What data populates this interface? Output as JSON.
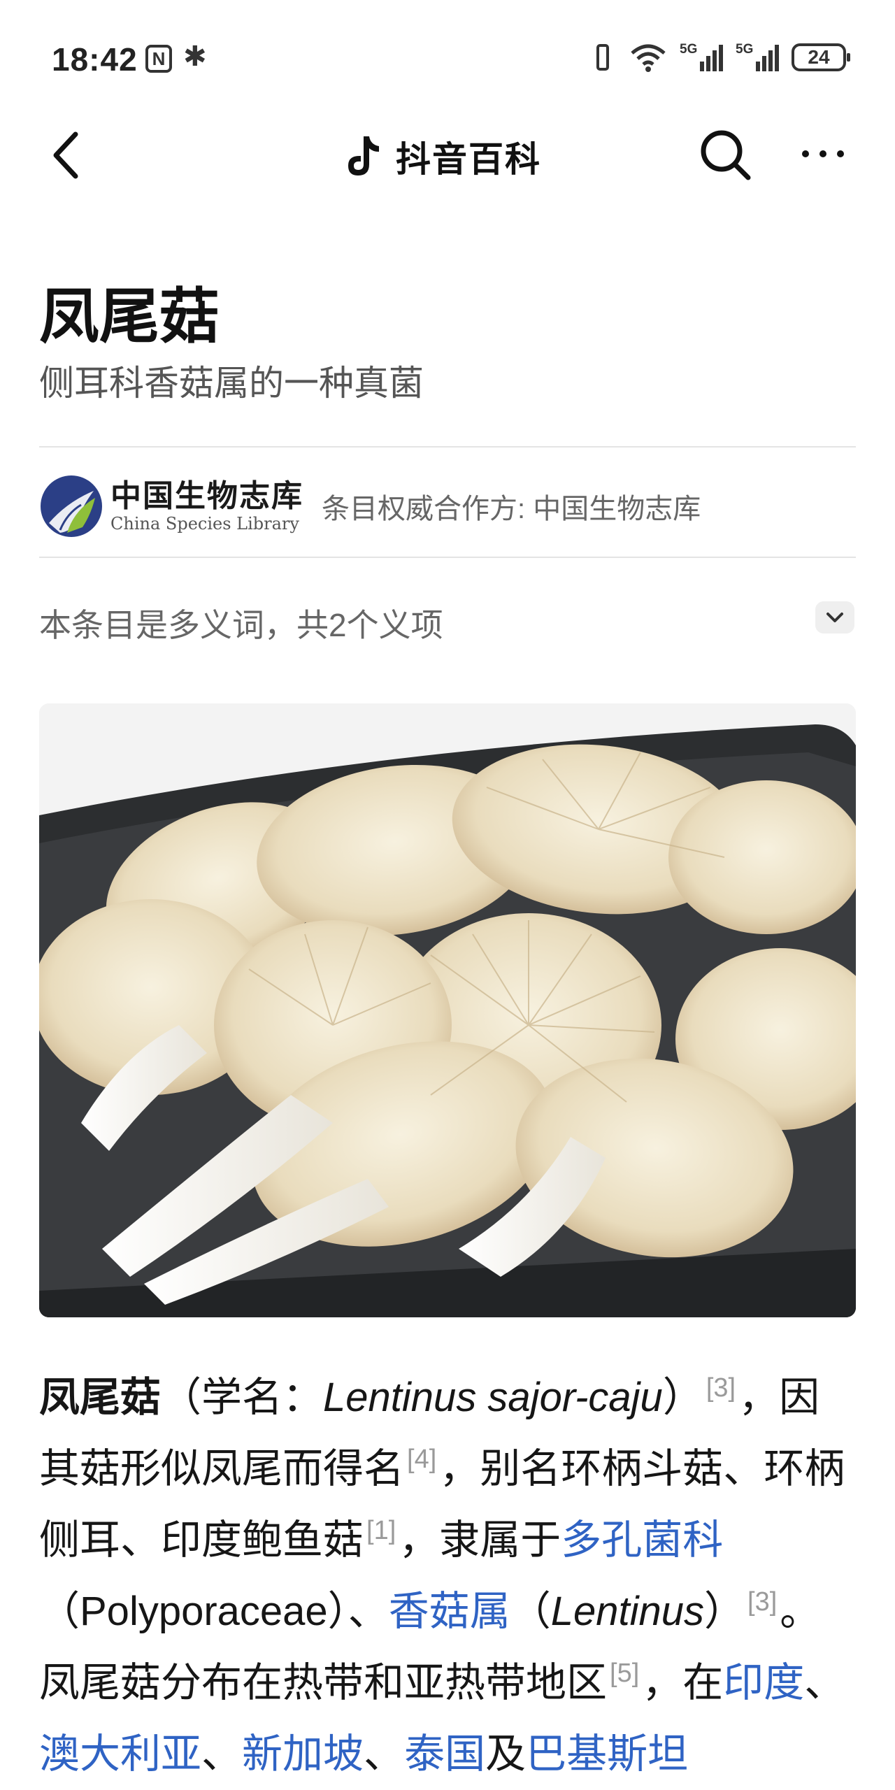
{
  "status_bar": {
    "time": "18:42",
    "nfc_label": "N",
    "signal1_tag": "5G",
    "signal2_tag": "5G",
    "battery": "24"
  },
  "nav": {
    "app_name": "抖音百科"
  },
  "entry": {
    "title": "凤尾菇",
    "subtitle": "侧耳科香菇属的一种真菌"
  },
  "partner": {
    "logo_cn": "中国生物志库",
    "logo_en": "China Species Library",
    "text": "条目权威合作方: 中国生物志库"
  },
  "polysemy": {
    "text": "本条目是多义词，共2个义项"
  },
  "article": {
    "term": "凤尾菇",
    "p1": "（学名：",
    "latin_name": "Lentinus sajor-caju",
    "p2": "）",
    "ref3": "[3]",
    "p3": "，因其菇形似凤尾而得名",
    "ref4": "[4]",
    "p4": "，别名环柄斗菇、环柄侧耳、印度鲍鱼菇",
    "ref1": "[1]",
    "p5": "，隶属于",
    "link_family": "多孔菌科",
    "p6": "（Polyporaceae）、",
    "link_genus": "香菇属",
    "p7": "（",
    "genus_latin": "Lentinus",
    "p8": "）",
    "ref3b": "[3]",
    "p9": "。凤尾菇分布在热带和亚热带地区",
    "ref5": "[5]",
    "p10": "，在",
    "link_india": "印度",
    "sep1": "、",
    "link_australia": "澳大利亚",
    "sep2": "、",
    "link_singapore": "新加坡",
    "sep3": "、",
    "link_thailand": "泰国",
    "p11": "及",
    "link_pakistan": "巴基斯坦"
  }
}
